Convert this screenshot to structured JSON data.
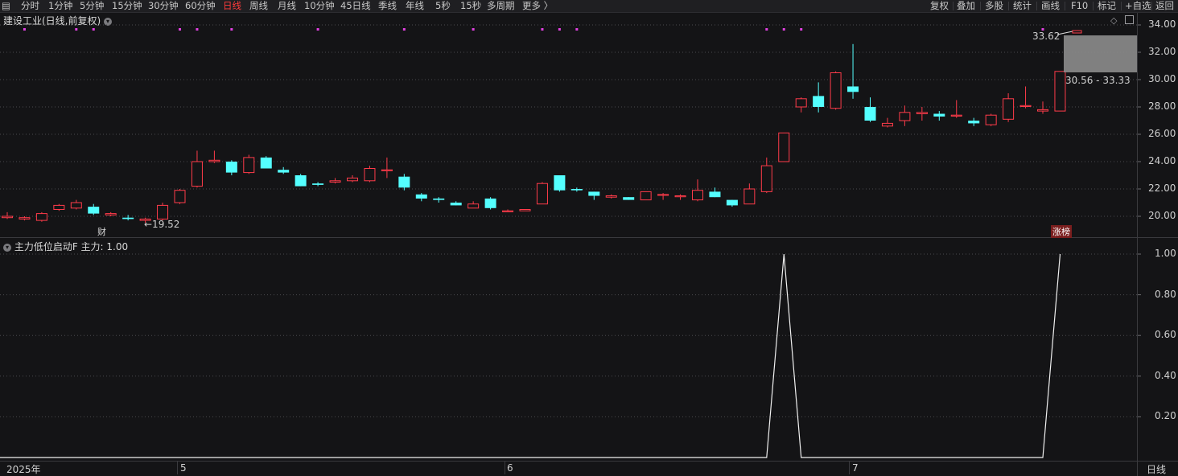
{
  "toolbar": {
    "left_items": [
      "分时",
      "1分钟",
      "5分钟",
      "15分钟",
      "30分钟",
      "60分钟",
      "日线",
      "周线",
      "月线",
      "10分钟",
      "45日线",
      "季线",
      "年线",
      "5秒",
      "15秒",
      "多周期",
      "更多 〉"
    ],
    "active_index": 6,
    "right_items": [
      "复权",
      "叠加",
      "多股",
      "统计",
      "画线",
      "F10",
      "标记",
      "+自选",
      "返回"
    ]
  },
  "main_chart": {
    "title": "建设工业(日线,前复权)",
    "y_ticks": [
      "34.00",
      "32.00",
      "30.00",
      "28.00",
      "26.00",
      "24.00",
      "22.00",
      "20.00"
    ],
    "high_label": "33.62",
    "low_label": "←19.52",
    "range_label": "30.56 - 33.33",
    "badge_cai": "财",
    "badge_zhangbang": "涨榜",
    "colors": {
      "up": "#ff3b4a",
      "down": "#54ffff",
      "bg": "#141416",
      "grid": "#4a4a4e",
      "range_box": "#8a8a8a",
      "marker": "#e040e0"
    }
  },
  "indicator": {
    "title": "主力低位启动F 主力: 1.00",
    "y_ticks": [
      "1.00",
      "0.80",
      "0.60",
      "0.40",
      "0.20"
    ]
  },
  "x_axis": {
    "labels": [
      "2025年",
      "5",
      "6",
      "7"
    ],
    "period": "日线"
  },
  "chart_data": {
    "type": "candlestick",
    "y_range": [
      18.9,
      34.2
    ],
    "candles": [
      [
        19.9,
        20.3,
        19.8,
        20.0
      ],
      [
        19.8,
        20.0,
        19.7,
        19.9
      ],
      [
        19.7,
        20.3,
        19.6,
        20.2
      ],
      [
        20.5,
        20.9,
        20.4,
        20.8
      ],
      [
        20.6,
        21.2,
        20.5,
        21.0
      ],
      [
        20.7,
        20.9,
        20.1,
        20.2
      ],
      [
        20.1,
        20.3,
        20.0,
        20.2
      ],
      [
        19.9,
        20.1,
        19.7,
        19.8
      ],
      [
        19.7,
        19.9,
        19.52,
        19.8
      ],
      [
        19.8,
        21.0,
        19.7,
        20.8
      ],
      [
        21.0,
        22.0,
        20.9,
        21.9
      ],
      [
        22.2,
        24.8,
        22.1,
        24.0
      ],
      [
        24.0,
        24.8,
        23.9,
        24.1
      ],
      [
        24.0,
        24.1,
        23.0,
        23.2
      ],
      [
        23.2,
        24.5,
        23.1,
        24.3
      ],
      [
        24.3,
        24.4,
        23.5,
        23.5
      ],
      [
        23.4,
        23.6,
        23.1,
        23.2
      ],
      [
        23.0,
        23.1,
        22.2,
        22.2
      ],
      [
        22.4,
        22.5,
        22.2,
        22.3
      ],
      [
        22.5,
        22.8,
        22.4,
        22.6
      ],
      [
        22.6,
        23.0,
        22.5,
        22.8
      ],
      [
        22.6,
        23.7,
        22.5,
        23.5
      ],
      [
        23.4,
        24.3,
        22.8,
        23.4
      ],
      [
        22.9,
        23.1,
        21.9,
        22.1
      ],
      [
        21.6,
        21.7,
        21.1,
        21.3
      ],
      [
        21.3,
        21.4,
        21.0,
        21.2
      ],
      [
        21.0,
        21.1,
        20.8,
        20.8
      ],
      [
        20.6,
        21.1,
        20.6,
        20.9
      ],
      [
        21.3,
        21.4,
        20.5,
        20.6
      ],
      [
        20.4,
        20.5,
        20.3,
        20.4
      ],
      [
        20.4,
        20.5,
        20.4,
        20.5
      ],
      [
        20.9,
        22.5,
        20.9,
        22.4
      ],
      [
        23.0,
        23.0,
        21.8,
        21.9
      ],
      [
        22.0,
        22.1,
        21.8,
        21.9
      ],
      [
        21.8,
        21.8,
        21.2,
        21.5
      ],
      [
        21.4,
        21.6,
        21.3,
        21.5
      ],
      [
        21.4,
        21.4,
        21.2,
        21.2
      ],
      [
        21.2,
        21.8,
        21.2,
        21.8
      ],
      [
        21.6,
        21.7,
        21.2,
        21.6
      ],
      [
        21.5,
        21.6,
        21.2,
        21.5
      ],
      [
        21.2,
        22.7,
        21.1,
        21.9
      ],
      [
        21.8,
        22.1,
        21.4,
        21.4
      ],
      [
        21.2,
        21.2,
        20.7,
        20.8
      ],
      [
        20.9,
        22.4,
        20.9,
        22.0
      ],
      [
        21.8,
        24.3,
        21.7,
        23.7
      ],
      [
        24.0,
        26.1,
        24.0,
        26.1
      ],
      [
        28.0,
        28.7,
        27.6,
        28.6
      ],
      [
        28.8,
        29.8,
        27.6,
        28.0
      ],
      [
        27.9,
        30.6,
        27.8,
        30.5
      ],
      [
        29.5,
        32.6,
        28.6,
        29.1
      ],
      [
        28.0,
        28.7,
        26.9,
        27.0
      ],
      [
        26.6,
        27.2,
        26.5,
        26.8
      ],
      [
        27.0,
        28.1,
        26.6,
        27.6
      ],
      [
        27.5,
        28.0,
        27.0,
        27.6
      ],
      [
        27.5,
        27.7,
        27.0,
        27.3
      ],
      [
        27.4,
        28.5,
        27.2,
        27.4
      ],
      [
        27.0,
        27.2,
        26.6,
        26.8
      ],
      [
        26.7,
        27.5,
        26.6,
        27.4
      ],
      [
        27.1,
        29.0,
        26.9,
        28.6
      ],
      [
        28.1,
        29.5,
        27.9,
        28.1
      ],
      [
        27.7,
        28.4,
        27.5,
        27.8
      ],
      [
        27.7,
        30.6,
        27.7,
        30.6
      ]
    ],
    "marker_indices": [
      1,
      4,
      5,
      10,
      11,
      13,
      18,
      23,
      27,
      31,
      32,
      33,
      44,
      45,
      46,
      60
    ],
    "indicator_values": [
      0,
      0,
      0,
      0,
      0,
      0,
      0,
      0,
      0,
      0,
      0,
      0,
      0,
      0,
      0,
      0,
      0,
      0,
      0,
      0,
      0,
      0,
      0,
      0,
      0,
      0,
      0,
      0,
      0,
      0,
      0,
      0,
      0,
      0,
      0,
      0,
      0,
      0,
      0,
      0,
      0,
      0,
      0,
      0,
      0,
      1,
      0,
      0,
      0,
      0,
      0,
      0,
      0,
      0,
      0,
      0,
      0,
      0,
      0,
      0,
      0,
      1
    ],
    "indicator_range": [
      0,
      1.05
    ]
  }
}
